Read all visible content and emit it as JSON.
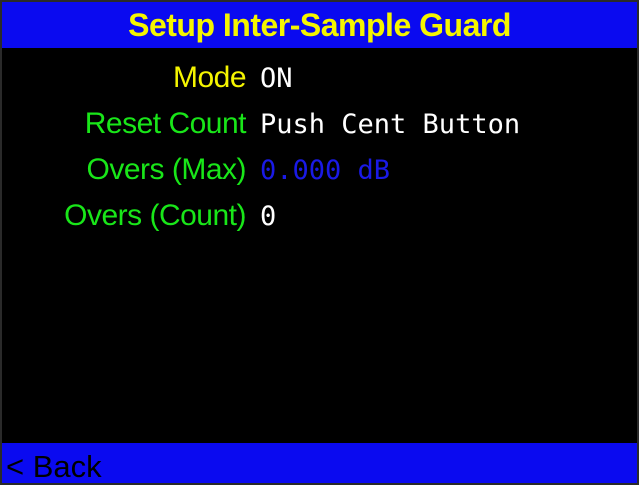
{
  "header": {
    "title": "Setup Inter-Sample Guard"
  },
  "settings": [
    {
      "label": "Mode",
      "value": "ON"
    },
    {
      "label": "Reset Count",
      "value": "Push Cent Button"
    },
    {
      "label": "Overs (Max)",
      "value": "0.000 dB"
    },
    {
      "label": "Overs (Count)",
      "value": "0"
    }
  ],
  "footer": {
    "back_label": "< Back"
  },
  "colors": {
    "bar_background": "#0a0af0",
    "screen_background": "#000000",
    "title_text": "#f5f500",
    "mode_label": "#f5f500",
    "setting_label": "#19e619",
    "value_text": "#ffffff",
    "highlight_value": "#1a1ae6"
  }
}
